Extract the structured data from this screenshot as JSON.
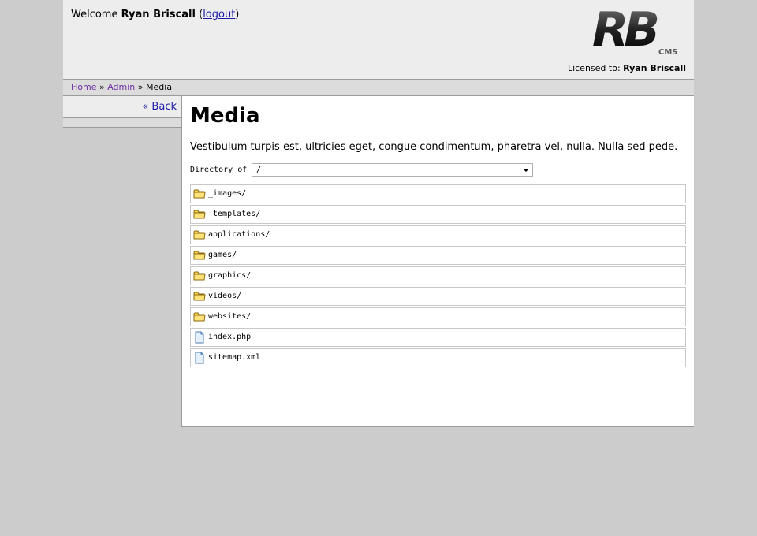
{
  "header": {
    "welcome_prefix": "Welcome",
    "user_name": "Ryan Briscall",
    "logout_label": "logout",
    "licensed_prefix": "Licensed to:",
    "licensed_name": "Ryan Briscall",
    "logo_text": "RB",
    "logo_sub": "CMS"
  },
  "breadcrumb": {
    "home": "Home",
    "admin": "Admin",
    "current": "Media",
    "separator": "»"
  },
  "sidebar": {
    "back_label": "« Back"
  },
  "main": {
    "title": "Media",
    "intro": "Vestibulum turpis est, ultricies eget, congue condimentum, pharetra vel, nulla. Nulla sed pede.",
    "directory_label": "Directory of",
    "directory_value": "/",
    "items": [
      {
        "name": "_images/",
        "type": "folder"
      },
      {
        "name": "_templates/",
        "type": "folder"
      },
      {
        "name": "applications/",
        "type": "folder"
      },
      {
        "name": "games/",
        "type": "folder"
      },
      {
        "name": "graphics/",
        "type": "folder"
      },
      {
        "name": "videos/",
        "type": "folder"
      },
      {
        "name": "websites/",
        "type": "folder"
      },
      {
        "name": "index.php",
        "type": "file"
      },
      {
        "name": "sitemap.xml",
        "type": "file"
      }
    ]
  },
  "colors": {
    "page_bg": "#cccccc",
    "header_bg": "#ededed",
    "link": "#1a1aa6",
    "visited_link": "#6b2fa0",
    "folder_icon": "#f5d24a"
  }
}
